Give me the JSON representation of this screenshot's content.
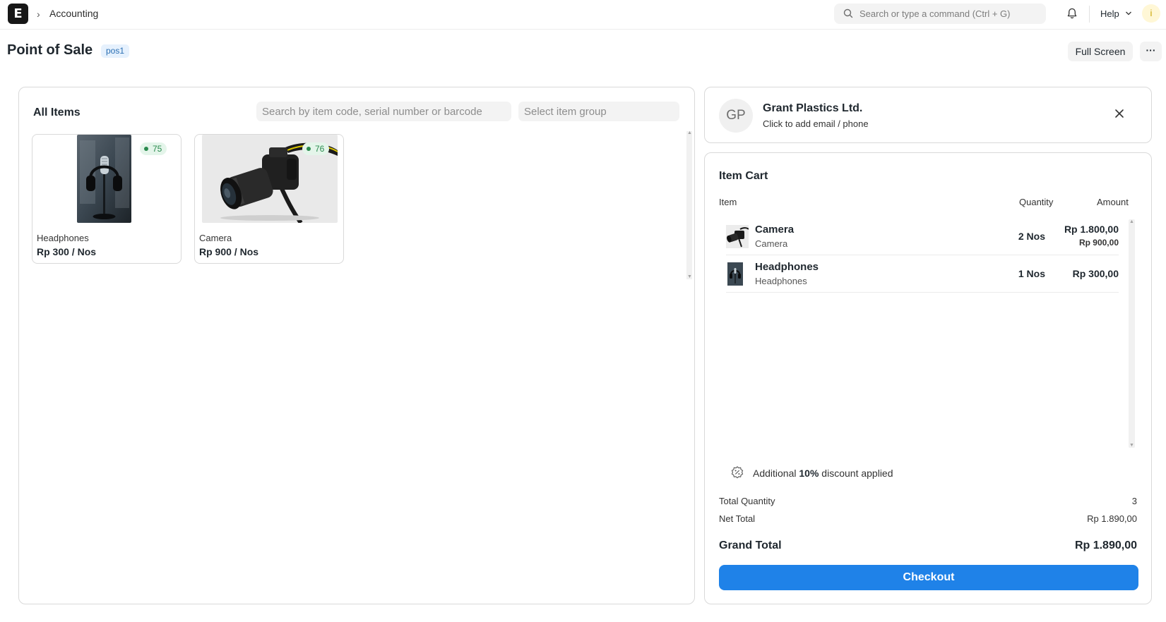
{
  "navbar": {
    "logo_letter": "E",
    "breadcrumb": "Accounting",
    "search_placeholder": "Search or type a command (Ctrl + G)",
    "help_label": "Help",
    "user_initial": "i"
  },
  "page": {
    "title": "Point of Sale",
    "badge": "pos1",
    "fullscreen_label": "Full Screen",
    "more_label": "···"
  },
  "items_panel": {
    "title": "All Items",
    "search_placeholder": "Search by item code, serial number or barcode",
    "group_placeholder": "Select item group",
    "items": [
      {
        "name": "Headphones",
        "price": "Rp 300 / Nos",
        "stock": "75"
      },
      {
        "name": "Camera",
        "price": "Rp 900 / Nos",
        "stock": "76"
      }
    ]
  },
  "customer": {
    "initials": "GP",
    "name": "Grant Plastics Ltd.",
    "contact_hint": "Click to add email / phone"
  },
  "cart": {
    "title": "Item Cart",
    "columns": {
      "item": "Item",
      "quantity": "Quantity",
      "amount": "Amount"
    },
    "rows": [
      {
        "name": "Camera",
        "sub": "Camera",
        "qty": "2 Nos",
        "amount": "Rp 1.800,00",
        "rate": "Rp 900,00"
      },
      {
        "name": "Headphones",
        "sub": "Headphones",
        "qty": "1 Nos",
        "amount": "Rp 300,00",
        "rate": ""
      }
    ],
    "discount": {
      "prefix": "Additional ",
      "value": "10%",
      "suffix": " discount applied"
    },
    "total_quantity_label": "Total Quantity",
    "total_quantity": "3",
    "net_total_label": "Net Total",
    "net_total": "Rp 1.890,00",
    "grand_total_label": "Grand Total",
    "grand_total": "Rp 1.890,00",
    "checkout_label": "Checkout"
  },
  "colors": {
    "primary": "#1f82e8",
    "stock_green": "#2a8a4e",
    "badge_blue": "#2a6fb3"
  }
}
